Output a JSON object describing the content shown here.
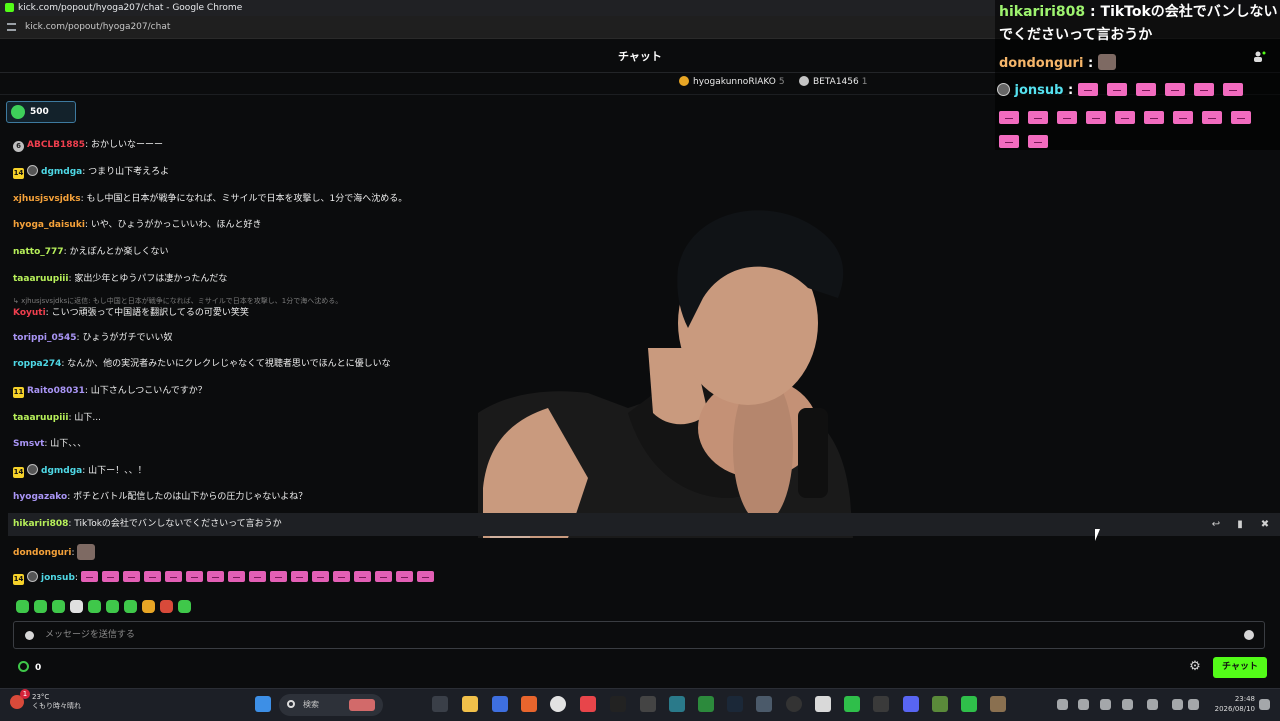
{
  "browser": {
    "window_title": "kick.com/popout/hyoga207/chat - Google Chrome",
    "url": "kick.com/popout/hyoga207/chat"
  },
  "chat_header": {
    "title": "チャット"
  },
  "leaderboard": [
    {
      "name": "hyogakunnoRIAKO",
      "count": "5",
      "color": "#e8a625"
    },
    {
      "name": "BETA1456",
      "count": "1",
      "color": "#c4c4c4"
    }
  ],
  "points": {
    "value": "500"
  },
  "messages": [
    {
      "badge": "circle",
      "badge_text": "6",
      "user": "ABCLB1885",
      "color": "#ef3f4e",
      "text": "おかしいなーーー"
    },
    {
      "badge": "sub",
      "badge_text": "14",
      "avatar": true,
      "user": "dgmdga",
      "color": "#4fd9e6",
      "text": "つまり山下考えろよ"
    },
    {
      "user": "xjhusjsvsjdks",
      "color": "#f5a23a",
      "text": "もし中国と日本が戦争になれば、ミサイルで日本を攻撃し、1分で海へ沈める。"
    },
    {
      "user": "hyoga_daisuki",
      "color": "#f5a23a",
      "text": "いや、ひょうがかっこいいわ、ほんと好き"
    },
    {
      "user": "natto_777",
      "color": "#b7f05a",
      "text": "かえぽんとか楽しくない"
    },
    {
      "user": "taaaruupiii",
      "color": "#b7f05a",
      "text": "家出少年とゆうパフは凄かったんだな"
    },
    {
      "user": "Koyuti",
      "color": "#ef3f4e",
      "text": "こいつ頑張って中国語を翻訳してるの可愛い笑笑"
    },
    {
      "user": "torippi_0545",
      "color": "#a995f5",
      "text": "ひょうがガチでいい奴"
    },
    {
      "user": "roppa274",
      "color": "#4fd9e6",
      "text": "なんか、他の実況者みたいにクレクレじゃなくて視聴者思いでほんとに優しいな"
    },
    {
      "badge": "sub",
      "badge_text": "11",
      "user": "Raito08031",
      "color": "#a995f5",
      "text": "山下さんしつこいんですか？"
    },
    {
      "user": "taaaruupiii",
      "color": "#b7f05a",
      "text": "山下..."
    },
    {
      "user": "Smsvt",
      "color": "#a995f5",
      "text": "山下、、、"
    },
    {
      "badge": "sub",
      "badge_text": "14",
      "avatar": true,
      "user": "dgmdga",
      "color": "#4fd9e6",
      "text": "山下ー！、、！"
    },
    {
      "user": "hyogazako",
      "color": "#a995f5",
      "text": "ポチとバトル配信したのは山下からの圧力じゃないよね？"
    },
    {
      "user": "hikariri808",
      "color": "#b7f05a",
      "text": "TikTokの会社でバンしないでくださいって言おうか"
    },
    {
      "user": "dondonguri",
      "color": "#f5a23a",
      "text": ""
    },
    {
      "badge": "sub",
      "badge_text": "14",
      "avatar": true,
      "user": "jonsub",
      "color": "#4fd9e6",
      "text": ""
    }
  ],
  "reply_context": "xjhusjsvsjdksに返信: もし中国と日本が戦争になれば、ミサイルで日本を攻撃し、1分で海へ沈める。",
  "overlay": {
    "line1_user": "hikariri808",
    "line1_sep": " : ",
    "line1_text": "TikTokの会社でバンしない",
    "line2_text": "でくださいって言おうか",
    "line3_user": "dondonguri",
    "line3_sep": " : ",
    "line4_user": "jonsub",
    "line4_sep": " : "
  },
  "input": {
    "placeholder": "メッセージを送信する"
  },
  "footer": {
    "points": "0",
    "send_label": "チャット"
  },
  "taskbar": {
    "temperature": "23°C",
    "weather": "くもり時々晴れ",
    "search_label": "検索",
    "time": "23:48",
    "date": "2026/08/10",
    "notification_count": "1"
  },
  "icons": {
    "brand_green": "#53fc18",
    "emote_pink": "#e35fb5"
  }
}
